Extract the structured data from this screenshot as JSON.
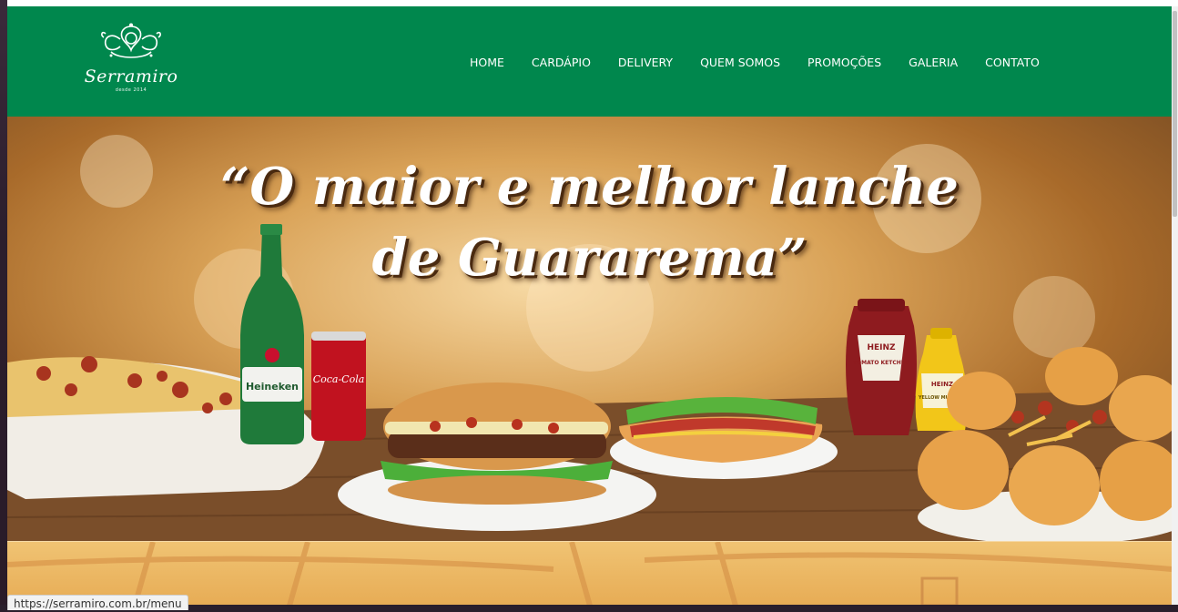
{
  "brand": {
    "name": "Serramiro",
    "tagline": "desde 2014",
    "color": "#00874d"
  },
  "nav": {
    "items": [
      "HOME",
      "CARDÁPIO",
      "DELIVERY",
      "QUEM SOMOS",
      "PROMOÇÕES",
      "GALERIA",
      "CONTATO"
    ]
  },
  "hero": {
    "line1": "“O maior e melhor lanche",
    "line2": "de Guararema”",
    "labels": {
      "beer": "Heineken",
      "soda": "Coca-Cola",
      "ketchup": "TOMATO KETCHUP",
      "ketchup_brand": "HEINZ",
      "mustard": "YELLOW MUSTARD",
      "mustard_brand": "HEINZ"
    }
  },
  "status_bar": {
    "url": "https://serramiro.com.br/menu"
  }
}
